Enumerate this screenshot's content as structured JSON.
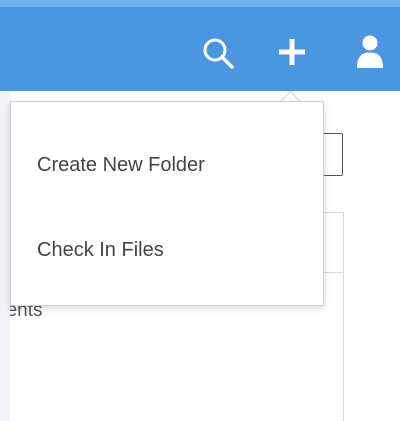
{
  "header": {
    "background_color": "#4a96e0",
    "icons": [
      "search-icon",
      "plus-icon",
      "user-icon"
    ]
  },
  "add_menu": {
    "items": [
      {
        "label": "Create New Folder"
      },
      {
        "label": "Check In Files"
      }
    ]
  },
  "background": {
    "partial_text": "nents"
  }
}
